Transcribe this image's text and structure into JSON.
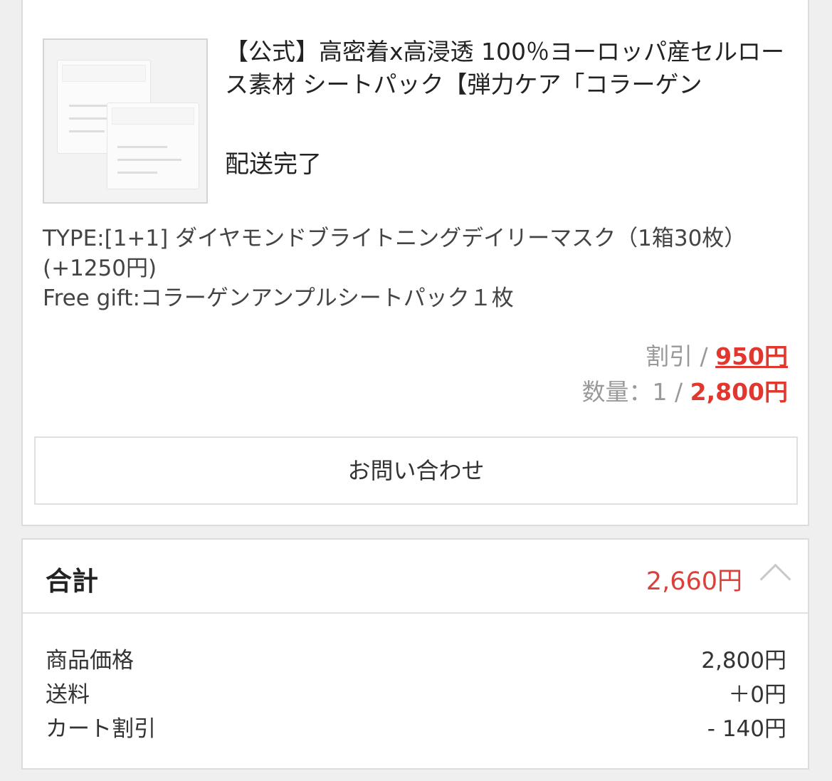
{
  "order": {
    "product_title": "【公式】高密着x高浸透 100％ヨーロッパ産セルロース素材 シートパック【弾力ケア「コラーゲン",
    "status": "配送完了",
    "option_lines": [
      "TYPE:[1+1] ダイヤモンドブライトニングデイリーマスク（1箱30枚）(+1250円)",
      "Free gift:コラーゲンアンプルシートパック１枚"
    ],
    "discount_label": "割引 / ",
    "discount_value": "950円",
    "qty_label": "数量：1 / ",
    "qty_price": "2,800円",
    "inquiry_label": "お問い合わせ"
  },
  "total": {
    "label": "合計",
    "value": "2,660円",
    "rows": [
      {
        "label": "商品価格",
        "value": "2,800円"
      },
      {
        "label": "送料",
        "value": "＋0円"
      },
      {
        "label": "カート割引",
        "value": "- 140円"
      }
    ]
  }
}
